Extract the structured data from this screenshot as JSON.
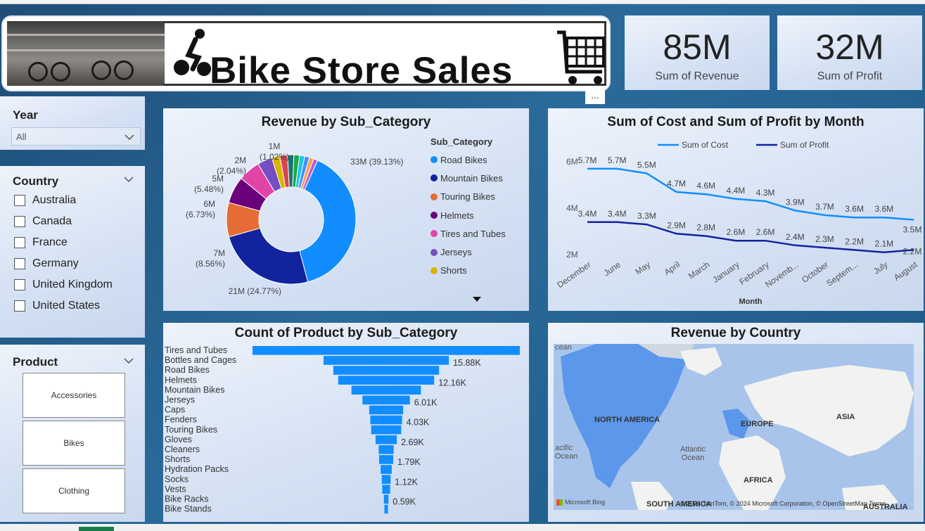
{
  "banner": {
    "title": "Bike Store Sales"
  },
  "kpis": [
    {
      "value": "85M",
      "label": "Sum of Revenue"
    },
    {
      "value": "32M",
      "label": "Sum of Profit"
    }
  ],
  "more_options": "...",
  "slicers": {
    "year": {
      "title": "Year",
      "selected": "All"
    },
    "country": {
      "title": "Country",
      "options": [
        "Australia",
        "Canada",
        "France",
        "Germany",
        "United Kingdom",
        "United States"
      ]
    },
    "product": {
      "title": "Product",
      "tiles": [
        "Accessories",
        "Bikes",
        "Clothing"
      ]
    }
  },
  "colors": {
    "accent": "#118dff",
    "dark_navy": "#12239e",
    "orange": "#e66c37",
    "purple": "#6b007b",
    "pink": "#e044a7"
  },
  "chart_data": [
    {
      "id": "revenue_by_subcategory",
      "type": "pie",
      "variant": "donut",
      "title": "Revenue by Sub_Category",
      "legend_title": "Sub_Category",
      "legend_position": "right",
      "legend": [
        "Road Bikes",
        "Mountain Bikes",
        "Touring Bikes",
        "Helmets",
        "Tires and Tubes",
        "Jerseys",
        "Shorts"
      ],
      "slices": [
        {
          "name": "Road Bikes",
          "value": 33,
          "pct": 39.13,
          "label": "33M (39.13%)",
          "color": "#118dff"
        },
        {
          "name": "Mountain Bikes",
          "value": 21,
          "pct": 24.77,
          "label": "21M (24.77%)",
          "color": "#12239e"
        },
        {
          "name": "Touring Bikes",
          "value": 7,
          "pct": 8.56,
          "label": "7M (8.56%)",
          "color": "#e66c37"
        },
        {
          "name": "Helmets",
          "value": 6,
          "pct": 6.73,
          "label": "6M (6.73%)",
          "color": "#6b007b"
        },
        {
          "name": "Tires and Tubes",
          "value": 5,
          "pct": 5.48,
          "label": "5M (5.48%)",
          "color": "#e044a7"
        },
        {
          "name": "Jerseys",
          "value": 3,
          "pct": 3.7,
          "label": "",
          "color": "#744ec2"
        },
        {
          "name": "Shorts",
          "value": 2,
          "pct": 2.04,
          "label": "2M (2.04%)",
          "color": "#d9b300"
        },
        {
          "name": "",
          "value": 1,
          "pct": 1.9,
          "label": "",
          "color": "#d64550"
        },
        {
          "name": "",
          "value": 1,
          "pct": 1.6,
          "label": "",
          "color": "#197278"
        },
        {
          "name": "",
          "value": 1,
          "pct": 1.4,
          "label": "",
          "color": "#1aab40"
        },
        {
          "name": "",
          "value": 1,
          "pct": 1.3,
          "label": "",
          "color": "#15c6f4"
        },
        {
          "name": "",
          "value": 1,
          "pct": 1.2,
          "label": "",
          "color": "#4092ff"
        },
        {
          "name": "",
          "value": 1,
          "pct": 1.08,
          "label": "",
          "color": "#ffa058"
        },
        {
          "name": "",
          "value": 1,
          "pct": 1.02,
          "label": "1M (1.02%)",
          "color": "#be5dc9"
        }
      ]
    },
    {
      "id": "cost_profit_by_month",
      "type": "line",
      "title": "Sum of Cost and Sum of Profit by Month",
      "xlabel": "Month",
      "legend_position": "top-center",
      "categories": [
        "December",
        "June",
        "May",
        "April",
        "March",
        "January",
        "February",
        "Novemb...",
        "October",
        "Septem...",
        "July",
        "August"
      ],
      "ylim": [
        2,
        6
      ],
      "yticks": [
        "2M",
        "4M",
        "6M"
      ],
      "series": [
        {
          "name": "Sum of Cost",
          "color": "#118dff",
          "values": [
            5.7,
            5.7,
            5.5,
            4.7,
            4.6,
            4.4,
            4.3,
            3.9,
            3.7,
            3.6,
            3.6,
            3.5
          ],
          "labels": [
            "5.7M",
            "5.7M",
            "5.5M",
            "4.7M",
            "4.6M",
            "4.4M",
            "4.3M",
            "3.9M",
            "3.7M",
            "3.6M",
            "3.6M",
            "3.5M"
          ]
        },
        {
          "name": "Sum of Profit",
          "color": "#12239e",
          "values": [
            3.4,
            3.4,
            3.3,
            2.9,
            2.8,
            2.6,
            2.6,
            2.4,
            2.3,
            2.2,
            2.1,
            2.2
          ],
          "labels": [
            "3.4M",
            "3.4M",
            "3.3M",
            "2.9M",
            "2.8M",
            "2.6M",
            "2.6M",
            "2.4M",
            "2.3M",
            "2.2M",
            "2.1M",
            "2.2M"
          ]
        }
      ]
    },
    {
      "id": "count_product_by_subcategory",
      "type": "bar",
      "variant": "funnel",
      "title": "Count of Product by Sub_Category",
      "categories": [
        "Tires and Tubes",
        "Bottles and Cages",
        "Road Bikes",
        "Helmets",
        "Mountain Bikes",
        "Jerseys",
        "Caps",
        "Fenders",
        "Touring Bikes",
        "Gloves",
        "Cleaners",
        "Shorts",
        "Hydration Packs",
        "Socks",
        "Vests",
        "Bike Racks",
        "Bike Stands"
      ],
      "values": [
        33.87,
        15.88,
        13.4,
        12.16,
        8.8,
        6.01,
        4.3,
        4.03,
        3.8,
        2.69,
        1.9,
        1.79,
        1.4,
        1.12,
        1.0,
        0.59,
        0.45
      ],
      "labels": [
        "",
        "15.88K",
        "",
        "12.16K",
        "",
        "6.01K",
        "",
        "4.03K",
        "",
        "2.69K",
        "",
        "1.79K",
        "",
        "1.12K",
        "",
        "0.59K",
        ""
      ],
      "color": "#118dff"
    },
    {
      "id": "revenue_by_country",
      "type": "map",
      "title": "Revenue by Country",
      "map_labels": [
        "NORTH AMERICA",
        "EUROPE",
        "ASIA",
        "AFRICA",
        "SOUTH AMERICA",
        "AUSTRALIA",
        "Atlantic Ocean",
        "acific Ocean",
        "cean"
      ],
      "attribution": "© 2024 TomTom, © 2024 Microsoft Corporation, © OpenStreetMap  Terms",
      "provider": "Microsoft Bing"
    }
  ]
}
